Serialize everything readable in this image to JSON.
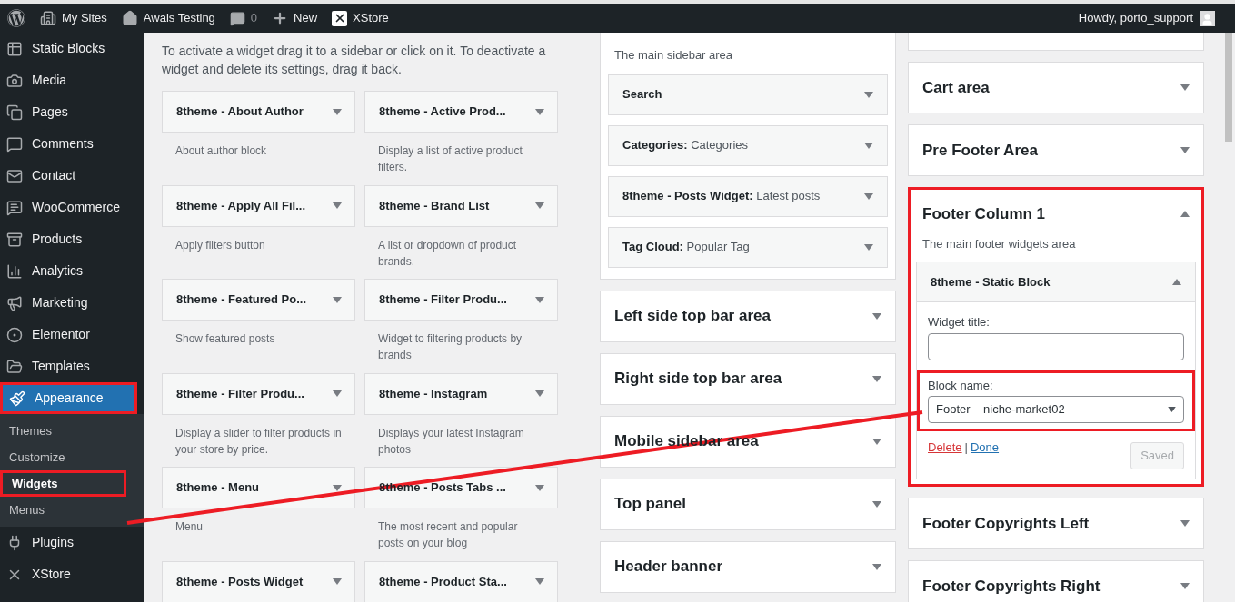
{
  "admin_bar": {
    "items": [
      {
        "kind": "sites",
        "label": "My Sites"
      },
      {
        "kind": "home",
        "label": "Awais Testing"
      },
      {
        "kind": "comments",
        "label": "0"
      },
      {
        "kind": "new",
        "label": "New"
      },
      {
        "kind": "xstore",
        "label": "XStore"
      }
    ],
    "greeting": "Howdy, porto_support"
  },
  "sidebar": {
    "items": [
      {
        "kind": "blocks",
        "label": "Static Blocks",
        "selected": false,
        "highlighted": false
      },
      {
        "kind": "media",
        "label": "Media",
        "selected": false,
        "highlighted": false
      },
      {
        "kind": "pages",
        "label": "Pages",
        "selected": false,
        "highlighted": false
      },
      {
        "kind": "comments",
        "label": "Comments",
        "selected": false,
        "highlighted": false
      },
      {
        "kind": "mail",
        "label": "Contact",
        "selected": false,
        "highlighted": false
      },
      {
        "kind": "woo",
        "label": "WooCommerce",
        "selected": false,
        "highlighted": false
      },
      {
        "kind": "products",
        "label": "Products",
        "selected": false,
        "highlighted": false
      },
      {
        "kind": "analytics",
        "label": "Analytics",
        "selected": false,
        "highlighted": false
      },
      {
        "kind": "marketing",
        "label": "Marketing",
        "selected": false,
        "highlighted": false
      },
      {
        "kind": "elementor",
        "label": "Elementor",
        "selected": false,
        "highlighted": false
      },
      {
        "kind": "templates",
        "label": "Templates",
        "selected": false,
        "highlighted": false
      },
      {
        "kind": "appearance",
        "label": "Appearance",
        "selected": true,
        "highlighted": true,
        "children": [
          {
            "label": "Themes",
            "selected": false,
            "highlighted": false
          },
          {
            "label": "Customize",
            "selected": false,
            "highlighted": false
          },
          {
            "label": "Widgets",
            "selected": true,
            "highlighted": true
          },
          {
            "label": "Menus",
            "selected": false,
            "highlighted": false
          }
        ]
      },
      {
        "kind": "plugins",
        "label": "Plugins",
        "selected": false,
        "highlighted": false
      },
      {
        "kind": "xstore",
        "label": "XStore",
        "selected": false,
        "highlighted": false
      }
    ]
  },
  "available_widgets": {
    "intro": "To activate a widget drag it to a sidebar or click on it. To deactivate a widget and delete its settings, drag it back.",
    "widgets": [
      {
        "title": "8theme - About Author",
        "description": "About author block"
      },
      {
        "title": "8theme - Active Prod...",
        "description": "Display a list of active product filters."
      },
      {
        "title": "8theme - Apply All Fil...",
        "description": "Apply filters button"
      },
      {
        "title": "8theme - Brand List",
        "description": "A list or dropdown of product brands."
      },
      {
        "title": "8theme - Featured Po...",
        "description": "Show featured posts"
      },
      {
        "title": "8theme - Filter Produ...",
        "description": "Widget to filtering products by brands"
      },
      {
        "title": "8theme - Filter Produ...",
        "description": "Display a slider to filter products in your store by price."
      },
      {
        "title": "8theme - Instagram",
        "description": "Displays your latest Instagram photos"
      },
      {
        "title": "8theme - Menu",
        "description": "Menu"
      },
      {
        "title": "8theme - Posts Tabs ...",
        "description": "The most recent and popular posts on your blog"
      },
      {
        "title": "8theme - Posts Widget"
      },
      {
        "title": "8theme - Product Sta..."
      }
    ]
  },
  "middle_column": {
    "open_area": {
      "description": "The main sidebar area",
      "widgets": [
        {
          "name": "Search"
        },
        {
          "name": "Categories:",
          "detail": "Categories"
        },
        {
          "name": "8theme - Posts Widget:",
          "detail": "Latest posts"
        },
        {
          "name": "Tag Cloud:",
          "detail": "Popular Tag"
        }
      ]
    },
    "areas": [
      {
        "title": "Left side top bar area",
        "expanded": false
      },
      {
        "title": "Right side top bar area",
        "expanded": false
      },
      {
        "title": "Mobile sidebar area",
        "expanded": false
      },
      {
        "title": "Top panel",
        "expanded": false
      },
      {
        "title": "Header banner",
        "expanded": false
      }
    ]
  },
  "right_column": {
    "areas": [
      {
        "title": "Cart area",
        "expanded": false
      },
      {
        "title": "Pre Footer Area",
        "expanded": false
      },
      {
        "title": "Footer Column 1",
        "expanded": true,
        "highlighted": true,
        "description": "The main footer widgets area",
        "widget": {
          "title": "8theme - Static Block",
          "expanded": true,
          "title_field": {
            "label": "Widget title:"
          },
          "block_field": {
            "label": "Block name:",
            "value": "Footer – niche-market02",
            "highlighted": true
          },
          "delete": "Delete",
          "separator": "|",
          "done": "Done",
          "save": {
            "label": "Saved",
            "disabled": true
          }
        }
      },
      {
        "title": "Footer Copyrights Left",
        "expanded": false
      },
      {
        "title": "Footer Copyrights Right",
        "expanded": false
      }
    ]
  },
  "annotations": {
    "connector_line": true
  }
}
